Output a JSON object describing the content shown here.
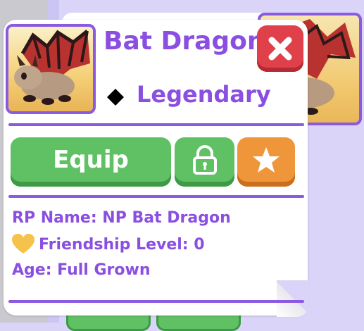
{
  "pet": {
    "name": "Bat Dragon",
    "rarity": "Legendary",
    "rarity_icon": "diamond-icon"
  },
  "actions": {
    "equip_label": "Equip",
    "lock_icon": "lock-icon",
    "favorite_icon": "star-icon",
    "close_icon": "close-icon"
  },
  "info": {
    "rp_name_line": "RP Name:  NP Bat Dragon",
    "friendship_line": "Friendship Level: 0",
    "age_line": "Age: Full Grown",
    "friendship_icon": "heart-icon"
  },
  "colors": {
    "accent_purple": "#8a4fe0",
    "equip_green": "#5fc064",
    "favorite_orange": "#f0963a",
    "close_red": "#e0404a",
    "heart_gold": "#f5c24c"
  }
}
